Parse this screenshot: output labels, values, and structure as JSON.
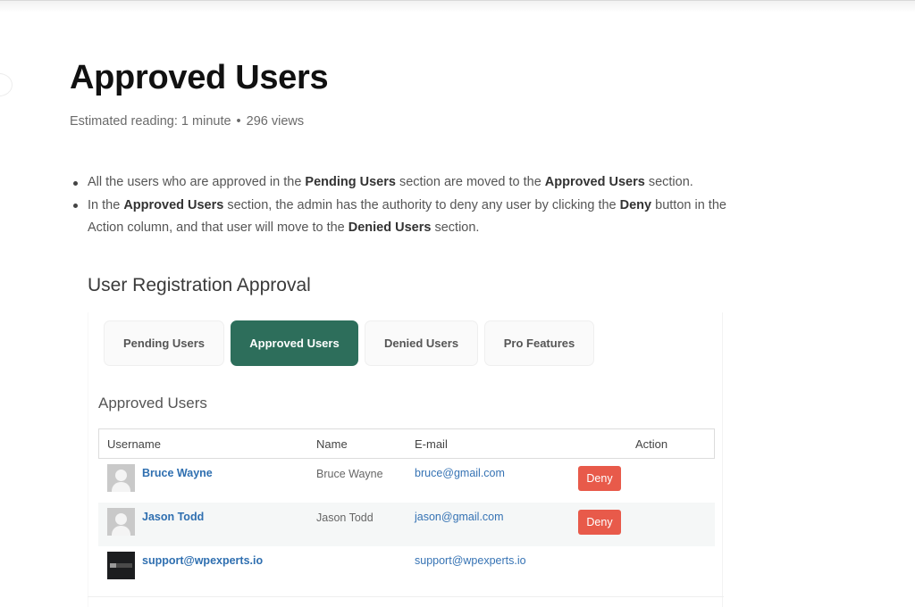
{
  "page": {
    "title": "Approved Users",
    "meta": {
      "reading": "Estimated reading: 1 minute",
      "separator": "•",
      "views": "296 views"
    },
    "bullets": [
      {
        "parts": [
          {
            "text": "All the users who are approved in the ",
            "bold": false
          },
          {
            "text": "Pending Users",
            "bold": true
          },
          {
            "text": " section are moved to the ",
            "bold": false
          },
          {
            "text": "Approved Users",
            "bold": true
          },
          {
            "text": " section.",
            "bold": false
          }
        ]
      },
      {
        "parts": [
          {
            "text": "In the ",
            "bold": false
          },
          {
            "text": "Approved Users",
            "bold": true
          },
          {
            "text": " section, the admin has the authority to deny any user by clicking the ",
            "bold": false
          },
          {
            "text": "Deny",
            "bold": true
          },
          {
            "text": " button in the Action column, and that user will move to the ",
            "bold": false
          },
          {
            "text": "Denied Users",
            "bold": true
          },
          {
            "text": " section.",
            "bold": false
          }
        ]
      }
    ]
  },
  "screenshot": {
    "title": "User Registration Approval",
    "tabs": [
      {
        "label": "Pending Users",
        "active": false
      },
      {
        "label": "Approved Users",
        "active": true
      },
      {
        "label": "Denied Users",
        "active": false
      },
      {
        "label": "Pro Features",
        "active": false
      }
    ],
    "section_title": "Approved Users",
    "table": {
      "headers": {
        "username": "Username",
        "name": "Name",
        "email": "E-mail",
        "action": "Action"
      },
      "rows": [
        {
          "username": "Bruce Wayne",
          "name": "Bruce Wayne",
          "email": "bruce@gmail.com",
          "action": "Deny",
          "avatar": "default-avatar-icon"
        },
        {
          "username": "Jason Todd",
          "name": "Jason Todd",
          "email": "jason@gmail.com",
          "action": "Deny",
          "avatar": "default-avatar-icon"
        },
        {
          "username": "support@wpexperts.io",
          "name": "",
          "email": "support@wpexperts.io",
          "action": "",
          "avatar": "wpexperts-logo-icon"
        }
      ]
    },
    "colors": {
      "active_tab": "#2d6e5b",
      "deny_button": "#e85a4a",
      "link": "#2f6fb0"
    }
  }
}
